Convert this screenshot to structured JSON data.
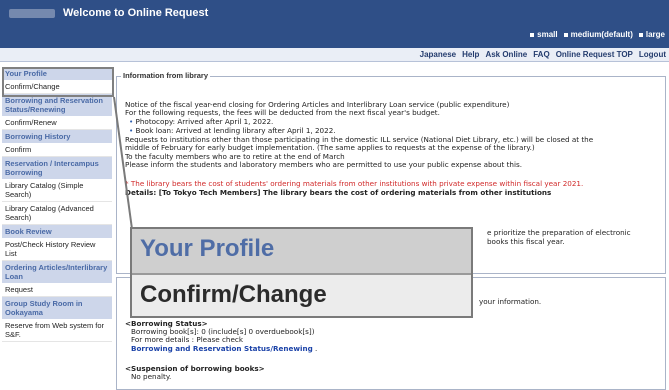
{
  "header": {
    "title": "Welcome to Online Request",
    "size_options": [
      "small",
      "medium(default)",
      "large"
    ]
  },
  "top_links": [
    "Japanese",
    "Help",
    "Ask Online",
    "FAQ",
    "Online Request TOP",
    "Logout"
  ],
  "sidebar": {
    "items": [
      {
        "label": "Your Profile",
        "kind": "head"
      },
      {
        "label": "Confirm/Change",
        "kind": "link"
      },
      {
        "label": "Borrowing and Reservation Status/Renewing",
        "kind": "head"
      },
      {
        "label": "Confirm/Renew",
        "kind": "link"
      },
      {
        "label": "Borrowing History",
        "kind": "head"
      },
      {
        "label": "Confirm",
        "kind": "link"
      },
      {
        "label": "Reservation / Intercampus Borrowing",
        "kind": "head"
      },
      {
        "label": "Library Catalog (Simple Search)",
        "kind": "link"
      },
      {
        "label": "Library Catalog (Advanced Search)",
        "kind": "link"
      },
      {
        "label": "Book Review",
        "kind": "head"
      },
      {
        "label": "Post/Check History Review List",
        "kind": "link"
      },
      {
        "label": "Ordering Articles/Interlibrary Loan",
        "kind": "head"
      },
      {
        "label": "Request",
        "kind": "link"
      },
      {
        "label": "Group Study Room in Ookayama",
        "kind": "head"
      },
      {
        "label": "Reserve from Web system for S&F.",
        "kind": "link"
      }
    ]
  },
  "info": {
    "legend": "Information from library",
    "line1": "Notice of the fiscal year-end closing for Ordering Articles and Interlibrary Loan service (public expenditure)",
    "line2": "For the following requests, the fees will be deducted from the next fiscal year's budget.",
    "bullet1": "Photocopy: Arrived after April 1, 2022.",
    "bullet2": "Book loan: Arrived at lending library after April 1, 2022.",
    "line3": "Requests to institutions other than those participating in the domestic ILL service (National Diet Library, etc.) will be closed at the",
    "line4": "middle of February for early budget implementation. (The same applies to requests at the expense of the library.)",
    "line5": "To the faculty members who are to retire at the end of March",
    "line6": "Please inform the students and laboratory members who are permitted to use your public expense about this.",
    "red_line": "* The library bears the cost of students' ordering materials from other institutions with private expense within fiscal year 2021.",
    "details": "Details: [To Tokyo Tech Members] The library bears the cost of ordering materials from other institutions",
    "partial1": "e prioritize the preparation of electronic",
    "partial2": "books this fiscal year."
  },
  "user_info": {
    "partial_info": "your information.",
    "borrowing_status_title": "<Borrowing Status>",
    "borrowing_books": "Borrowing book[s]: 0 (include[s] 0 overduebook[s])",
    "more_details": "For more details : Please check",
    "borrowing_link": "Borrowing and Reservation Status/Renewing",
    "link_period": ".",
    "suspension_title": "<Suspension of borrowing books>",
    "penalty": "No penalty."
  },
  "zoom": {
    "line1": "Your Profile",
    "line2": "Confirm/Change"
  }
}
